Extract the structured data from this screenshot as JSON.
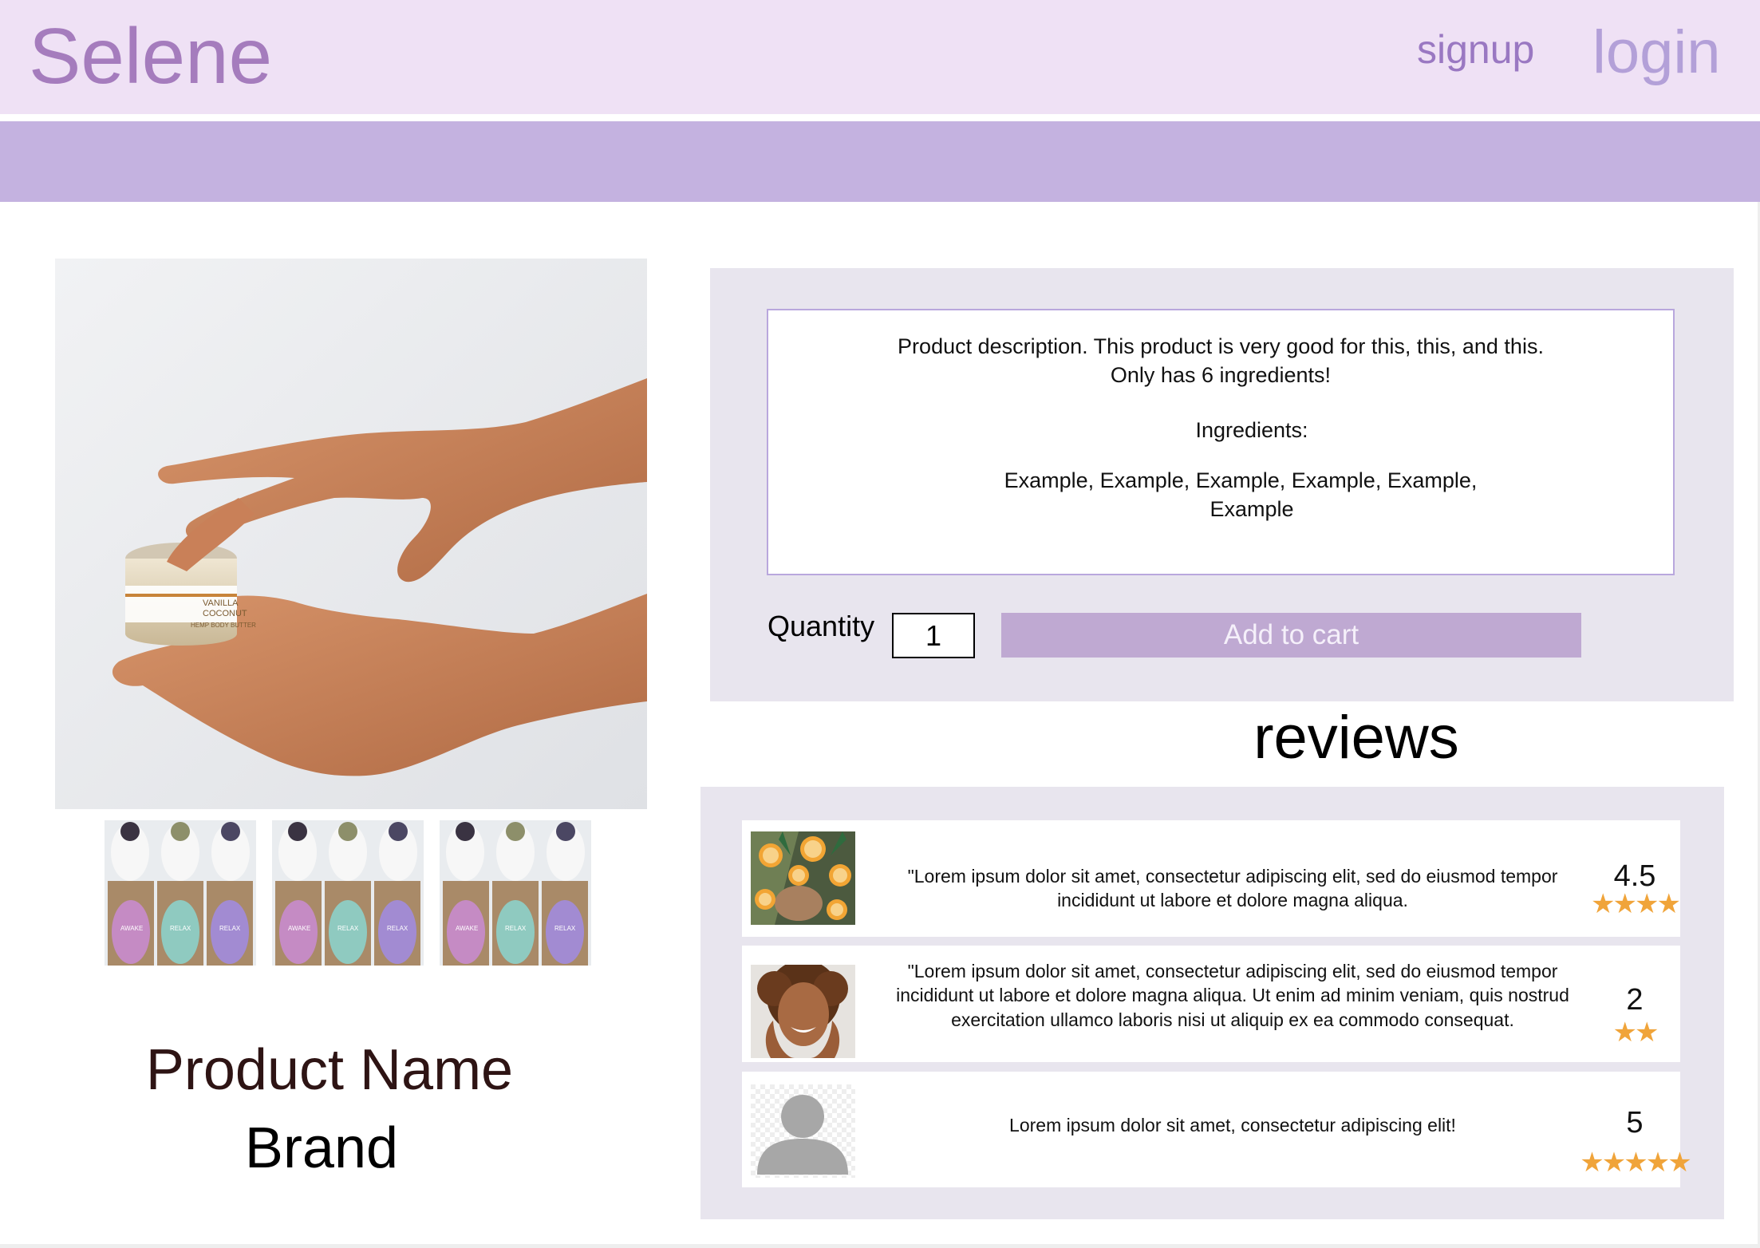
{
  "header": {
    "brand": "Selene",
    "signup_label": "signup",
    "login_label": "login"
  },
  "product": {
    "name": "Product Name",
    "brand": "Brand",
    "main_image_icon": "hand-with-cream-jar-photo",
    "jar_label_line1": "VANILLA",
    "jar_label_line2": "COCONUT",
    "jar_label_line3": "HEMP BODY BUTTER",
    "thumbnail_icon": "product-boxes-photo",
    "thumbnails": [
      {
        "box_labels": [
          "AWAKE",
          "RELAX",
          "RELAX"
        ]
      },
      {
        "box_labels": [
          "AWAKE",
          "RELAX",
          "RELAX"
        ]
      },
      {
        "box_labels": [
          "AWAKE",
          "RELAX",
          "RELAX"
        ]
      }
    ]
  },
  "details": {
    "description_line1": "Product description. This product is very good for this, this, and this.",
    "description_line2": "Only has 6 ingredients!",
    "ingredients_heading": "Ingredients:",
    "ingredients_line1": "Example, Example, Example, Example, Example,",
    "ingredients_line2": "Example",
    "quantity_label": "Quantity",
    "quantity_value": "1",
    "add_to_cart_label": "Add to cart"
  },
  "reviews": {
    "title": "reviews",
    "items": [
      {
        "image_icon": "citrus-face-photo",
        "text": "\"Lorem ipsum dolor sit amet, consectetur adipiscing elit, sed do eiusmod tempor incididunt ut labore et dolore magna aliqua.",
        "score": "4.5",
        "stars": "★★★★",
        "star_rating": 4.5
      },
      {
        "image_icon": "smiling-woman-photo",
        "text": "\"Lorem ipsum dolor sit amet, consectetur adipiscing elit, sed do eiusmod tempor incididunt ut labore et dolore magna aliqua. Ut enim ad minim veniam, quis nostrud exercitation ullamco laboris nisi ut aliquip ex ea commodo consequat.",
        "score": "2",
        "stars": "★★",
        "star_rating": 2
      },
      {
        "image_icon": "default-avatar-icon",
        "text": "Lorem ipsum dolor sit amet, consectetur adipiscing elit!",
        "score": "5",
        "stars": "★★★★★",
        "star_rating": 5
      }
    ]
  },
  "colors": {
    "header_bg": "#efe1f5",
    "brand": "#a57cbd",
    "nav_bar": "#c4b2e0",
    "panel_bg": "#e8e5ee",
    "button_bg": "#bfa9d2",
    "star": "#f0a43a"
  }
}
